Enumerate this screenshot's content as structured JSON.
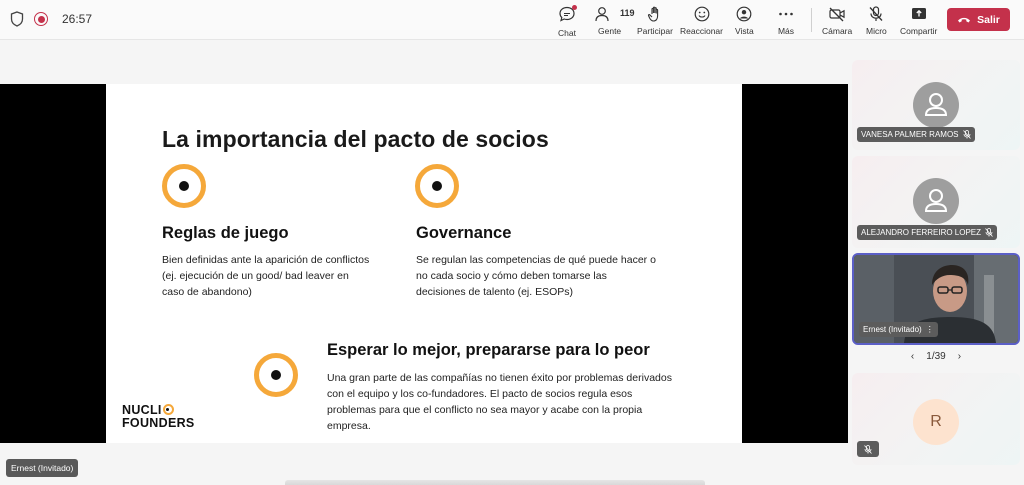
{
  "topbar": {
    "timer": "26:57",
    "chat_label": "Chat",
    "people_label": "Gente",
    "people_count": "119",
    "participate_label": "Participar",
    "react_label": "Reaccionar",
    "view_label": "Vista",
    "more_label": "Más",
    "camera_label": "Cámara",
    "mic_label": "Micro",
    "share_label": "Compartir",
    "leave_label": "Salir"
  },
  "slide": {
    "title": "La importancia del pacto de socios",
    "col1_heading": "Reglas de juego",
    "col1_body": "Bien definidas ante la aparición de conflictos (ej. ejecución de un good/ bad leaver en caso de abandono)",
    "col2_heading": "Governance",
    "col2_body": "Se regulan las competencias de qué puede hacer o no cada socio y cómo deben tomarse las decisiones de talento (ej. ESOPs)",
    "col3_heading": "Esperar lo mejor, prepararse para lo peor",
    "col3_body": "Una gran parte de las compañías no tienen éxito por problemas derivados con el equipo y los co-fundadores. El pacto de socios regula esos problemas para que el conflicto no sea mayor y acabe con la propia empresa.",
    "logo_line1": "NUCLI",
    "logo_line2": "FOUNDERS"
  },
  "presenter_name": "Ernest (Invitado)",
  "participants": [
    {
      "name": "VANESA PALMER RAMOS"
    },
    {
      "name": "ALEJANDRO FERREIRO LOPEZ"
    },
    {
      "name": "Ernest (Invitado)"
    },
    {
      "initial": "R"
    }
  ],
  "pager": {
    "text": "1/39"
  },
  "colors": {
    "accent": "#f5a83a",
    "leave": "#c4314b",
    "active_border": "#5b5fc7"
  }
}
